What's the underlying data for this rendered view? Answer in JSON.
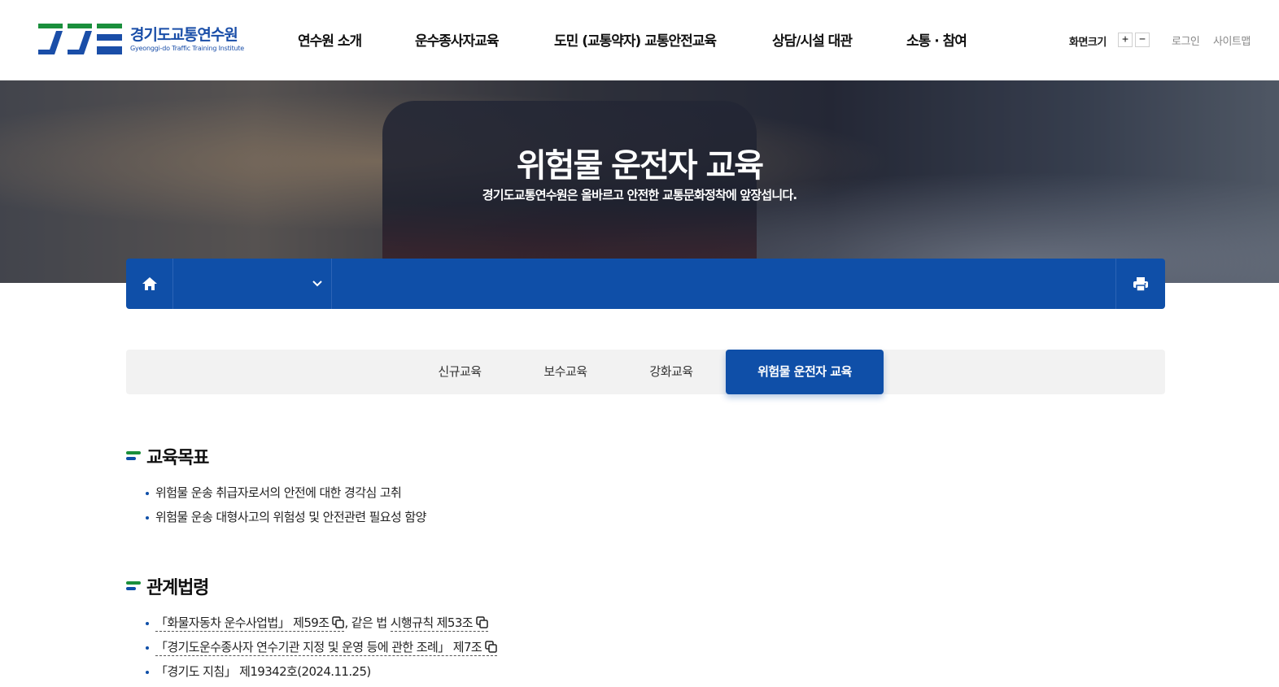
{
  "header": {
    "logo_ko": "경기도교통연수원",
    "logo_en": "Gyeonggi-do Traffic Training Institute",
    "nav": [
      "연수원 소개",
      "운수종사자교육",
      "도민 (교통약자) 교통안전교육",
      "상담/시설 대관",
      "소통 · 참여"
    ],
    "zoom_label": "화면크기",
    "zoom_plus": "+",
    "zoom_minus": "−",
    "login": "로그인",
    "sitemap": "사이트맵"
  },
  "hero": {
    "title": "위험물 운전자 교육",
    "subtitle": "경기도교통연수원은 올바르고 안전한 교통문화정착에 앞장섭니다."
  },
  "location": {
    "home_icon": "home-icon",
    "select_icon": "chevron-down-icon",
    "print_icon": "print-icon"
  },
  "tabs": [
    "신규교육",
    "보수교육",
    "강화교육",
    "위험물 운전자 교육"
  ],
  "active_tab": "위험물 운전자 교육",
  "sections": {
    "goal": {
      "title": "교육목표",
      "items": [
        "위험물 운송 취급자로서의 안전에 대한 경각심 고취",
        "위험물 운송 대형사고의 위험성 및 안전관련 필요성 함양"
      ]
    },
    "law": {
      "title": "관계법령",
      "item1_link1": "「화물자동차 운수사업법」 제59조",
      "item1_mid": ", 같은 법",
      "item1_link2": "시행규칙 제53조",
      "item2_link": "「경기도운수종사자 연수기관 지정 및 운영 등에 관한 조례」 제7조",
      "item3": "「경기도 지침」 제19342호(2024.11.25)"
    }
  },
  "colors": {
    "primary": "#0f4fa8",
    "green": "#1a8f3c",
    "tab_bg": "#f2f2f2"
  }
}
